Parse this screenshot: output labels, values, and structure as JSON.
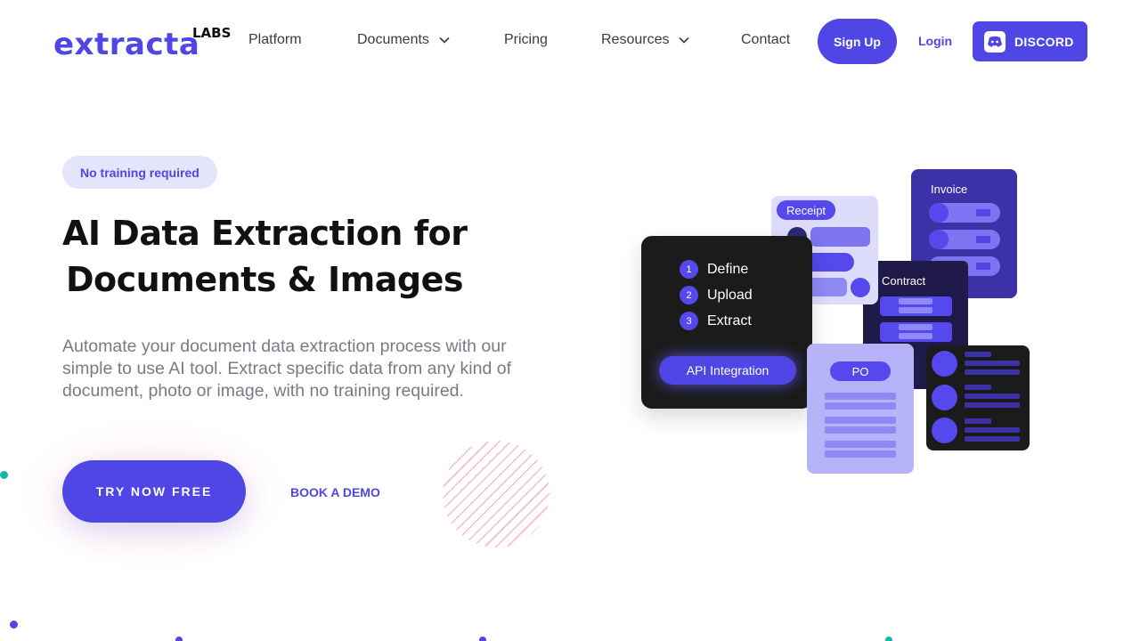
{
  "nav": {
    "logo_main": "extracta",
    "logo_sup": "LABS",
    "links": [
      {
        "label": "Platform",
        "dropdown": false
      },
      {
        "label": "Documents",
        "dropdown": true
      },
      {
        "label": "Pricing",
        "dropdown": false
      },
      {
        "label": "Resources",
        "dropdown": true
      },
      {
        "label": "Contact",
        "dropdown": false
      }
    ],
    "signup_label": "Sign Up",
    "login_label": "Login",
    "discord_label": "DISCORD",
    "discord_icon": "discord-icon"
  },
  "hero": {
    "badge": "No training required",
    "headline_line1": "AI Data Extraction for",
    "headline_line2": "Documents & Images",
    "subtext": "Automate your document data extraction process with our simple to use AI tool. Extract specific data from any kind of document, photo or image, with no training required.",
    "cta_primary": "TRY NOW FREE",
    "cta_secondary": "BOOK A DEMO"
  },
  "illustration": {
    "steps": [
      {
        "num": "1",
        "label": "Define"
      },
      {
        "num": "2",
        "label": "Upload"
      },
      {
        "num": "3",
        "label": "Extract"
      }
    ],
    "api_label": "API Integration",
    "receipt_label": "Receipt",
    "invoice_label": "Invoice",
    "contract_label": "Contract",
    "po_label": "PO"
  },
  "colors": {
    "brand": "#4f46e5",
    "badge_bg": "#e4e4fb",
    "dark_card": "#1b1b1b",
    "accent_teal": "#14b8a6"
  }
}
